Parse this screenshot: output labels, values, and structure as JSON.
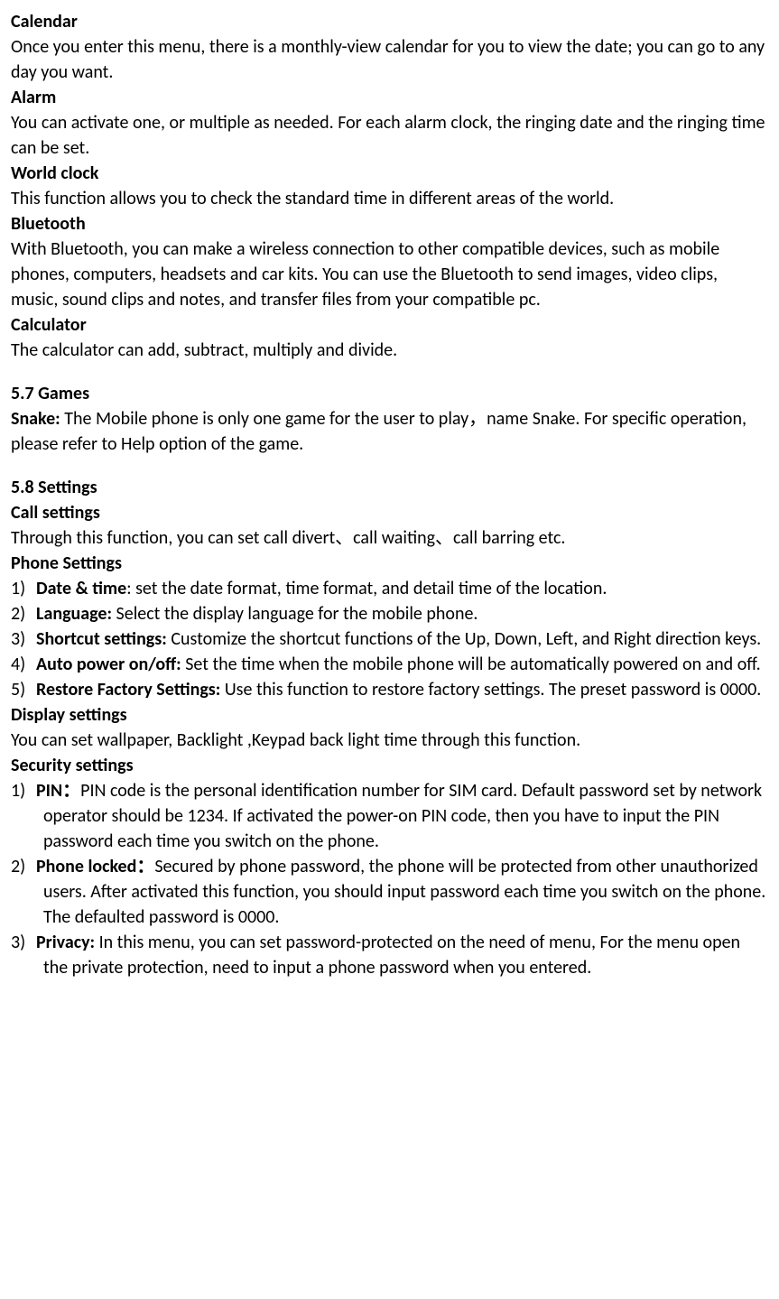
{
  "calendar": {
    "title": "Calendar",
    "body": "Once you enter this menu, there is a monthly-view calendar for you to view the date; you can go to any day you want."
  },
  "alarm": {
    "title": "Alarm",
    "body": "You can activate one, or multiple as needed. For each alarm clock, the ringing date and the ringing time can be set."
  },
  "world_clock": {
    "title": "World clock",
    "body": "This function allows you to check the standard time in different areas of the world."
  },
  "bluetooth": {
    "title": "Bluetooth",
    "body": "With Bluetooth, you can make a wireless connection to other compatible devices, such as mobile phones, computers, headsets and car kits. You can use the Bluetooth to send images, video clips, music, sound clips and notes, and transfer files from your compatible pc."
  },
  "calculator": {
    "title": "Calculator",
    "body": "The calculator can add, subtract, multiply and divide."
  },
  "games": {
    "title": "5.7 Games",
    "snake_label": "Snake:",
    "snake_body": " The Mobile phone is only one game for the user to play，name Snake. For specific operation, please refer to Help option of the game."
  },
  "settings": {
    "title": "5.8 Settings",
    "call_settings": {
      "title": "Call settings",
      "body": "Through this function, you can set call divert、call waiting、call barring etc."
    },
    "phone_settings": {
      "title": "Phone Settings",
      "items": [
        {
          "num": "1)",
          "label": "Date & time",
          "sep": ": ",
          "body": "set the date format, time format, and detail time of the location."
        },
        {
          "num": "2)",
          "label": "Language:",
          "sep": " ",
          "body": "Select the display language for the mobile phone."
        },
        {
          "num": "3)",
          "label": "Shortcut settings:",
          "sep": " ",
          "body": "Customize the shortcut functions of the Up, Down, Left, and Right direction keys."
        },
        {
          "num": "4)",
          "label": "Auto power on/off:",
          "sep": " ",
          "body": "Set the time when the mobile phone will be automatically powered on and off."
        },
        {
          "num": "5)",
          "label": "Restore Factory Settings:",
          "sep": " ",
          "body": "Use this function to restore factory settings. The preset password is 0000."
        }
      ]
    },
    "display_settings": {
      "title": "Display settings",
      "body": "You can set wallpaper, Backlight ,Keypad back light time through this function."
    },
    "security_settings": {
      "title": "Security settings",
      "items": [
        {
          "num": "1)",
          "label": "PIN：",
          "body": "PIN code is the personal identification number for SIM card. Default password set by network operator should be 1234. If activated the power-on PIN code, then you have to input the PIN password each time you switch on the phone."
        },
        {
          "num": "2)",
          "label": "Phone locked：",
          "body": "Secured by phone password, the phone will be protected from other unauthorized users. After activated this function, you should input password each time you switch on the phone. The defaulted password is 0000."
        },
        {
          "num": "3)",
          "label": "Privacy:",
          "body": " In this menu, you can set password-protected on the need of menu, For the menu open the private protection, need to input a phone password when you entered."
        }
      ]
    }
  }
}
